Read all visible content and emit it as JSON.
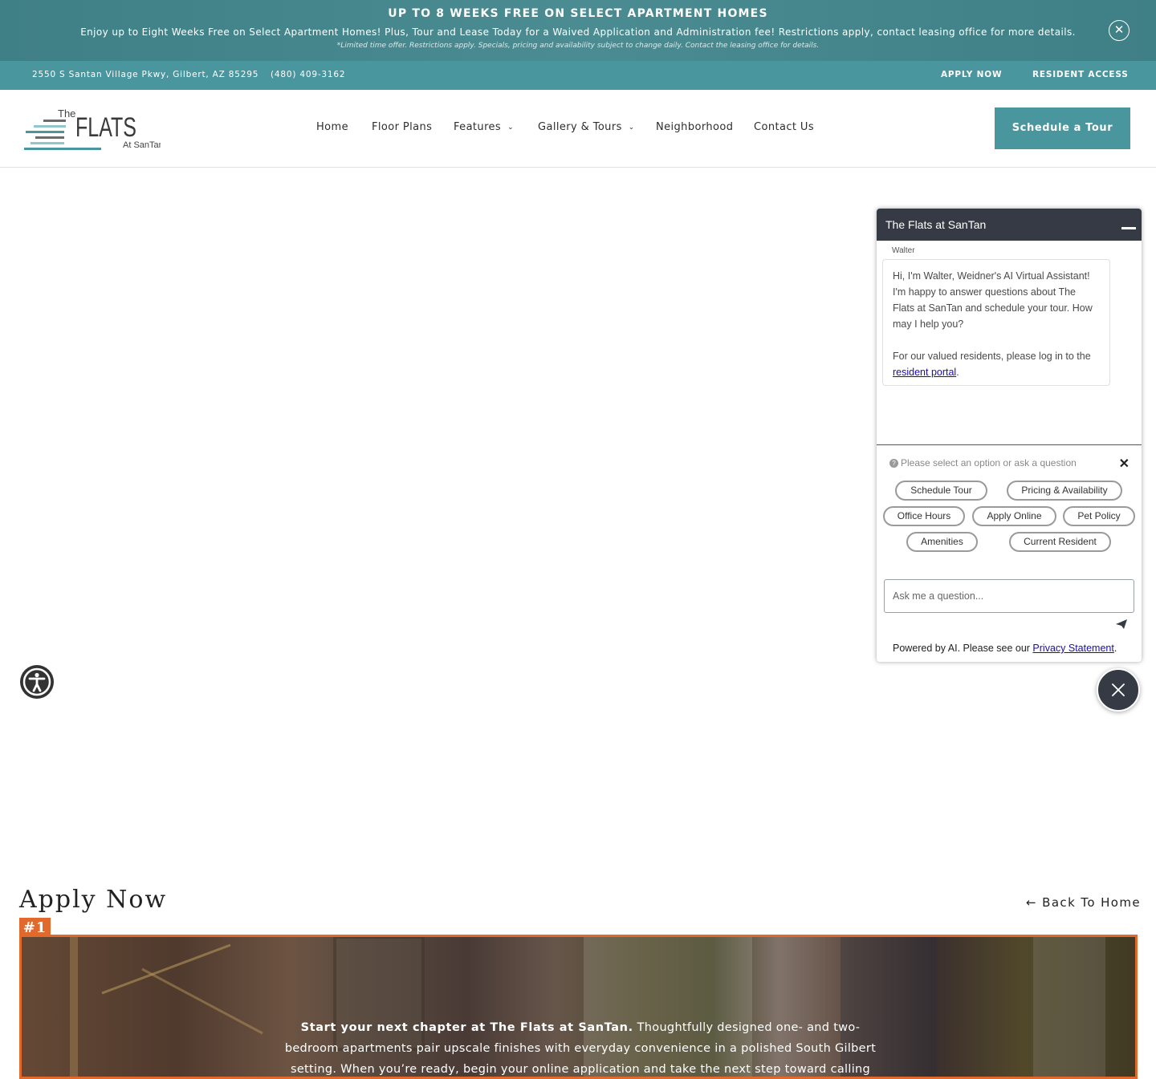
{
  "promo": {
    "title": "UP TO 8 WEEKS FREE ON SELECT APARTMENT HOMES",
    "text": "Enjoy up to Eight Weeks Free on Select Apartment Homes! Plus, Tour and Lease Today for a Waived Application and Administration fee! Restrictions apply, contact leasing office for more details.",
    "fine_print": "*Limited time offer. Restrictions apply. Specials, pricing and availability subject to change daily. Contact the leasing office for details.",
    "close_icon": "close-icon"
  },
  "utility": {
    "address": "2550 S Santan Village Pkwy, Gilbert, AZ 85295",
    "phone": "(480) 409-3162",
    "apply_now": "APPLY NOW",
    "resident_access": "RESIDENT ACCESS"
  },
  "header": {
    "logo": {
      "the": "The",
      "flats": "FLATS",
      "at_santan": "At SanTan"
    },
    "nav": [
      {
        "label": "Home"
      },
      {
        "label": "Floor Plans"
      },
      {
        "label": "Features"
      },
      {
        "label": "Gallery & Tours"
      },
      {
        "label": "Neighborhood"
      },
      {
        "label": "Contact Us"
      }
    ],
    "cta": "Schedule a Tour"
  },
  "chat": {
    "title": "The Flats at SanTan",
    "sender": "Walter",
    "message_1": "Hi, I'm Walter, Weidner's AI Virtual Assistant! I'm happy to answer questions about The Flats at SanTan and schedule your tour. How may I help you?",
    "message_2_prefix": "For our valued residents, please log in to the ",
    "message_2_link": "resident portal",
    "message_2_suffix": ".",
    "hint": "Please select an option or ask a question",
    "options": [
      "Schedule Tour",
      "Pricing & Availability",
      "Office Hours",
      "Apply Online",
      "Pet Policy",
      "Amenities",
      "Current Resident"
    ],
    "input_placeholder": "Ask me a question...",
    "footer_prefix": "Powered by AI. Please see our ",
    "footer_link": "Privacy Statement",
    "footer_suffix": "."
  },
  "apply": {
    "title": "Apply Now",
    "back_home": "← Back To Home",
    "badge": "#1",
    "hero_bold": "Start your next chapter at The Flats at SanTan.",
    "hero_text": " Thoughtfully designed one- and two-bedroom apartments pair upscale finishes with everyday convenience in a polished South Gilbert setting. When you’re ready, begin your online application and take the next step toward calling The Flats at SanTan"
  },
  "colors": {
    "teal": "#4a969f",
    "promo_teal": "#3f7f86",
    "chat_dark": "#353a45",
    "accent_orange": "#e2692c"
  }
}
